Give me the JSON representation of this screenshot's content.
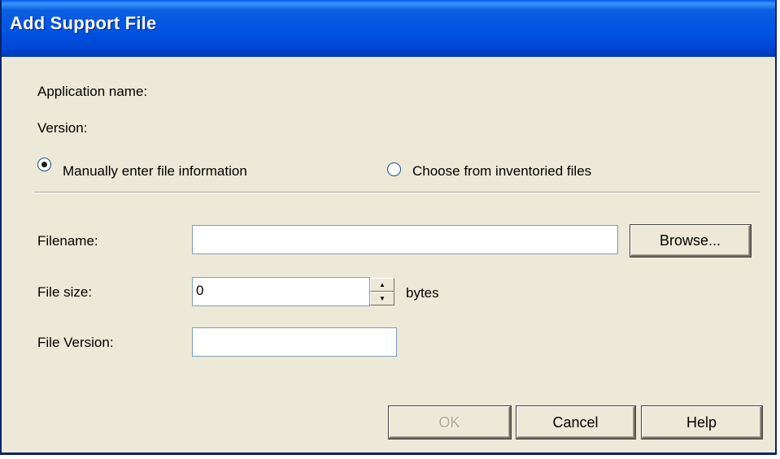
{
  "window": {
    "title": "Add Support File"
  },
  "info": {
    "application_name_label": "Application name:",
    "version_label": "Version:"
  },
  "source_options": [
    {
      "label": "Manually enter file information",
      "selected": true
    },
    {
      "label": "Choose from inventoried files",
      "selected": false
    }
  ],
  "form": {
    "filename_label": "Filename:",
    "filename_value": "",
    "file_size_label": "File size:",
    "file_size_value": "0",
    "file_size_unit": "bytes",
    "file_version_label": "File Version:",
    "file_version_value": ""
  },
  "buttons": {
    "browse": "Browse...",
    "ok": "OK",
    "cancel": "Cancel",
    "help": "Help"
  },
  "colors": {
    "titlebar": "#0055e5",
    "dialog_bg": "#ece9d8",
    "disabled_text": "#aca899"
  }
}
